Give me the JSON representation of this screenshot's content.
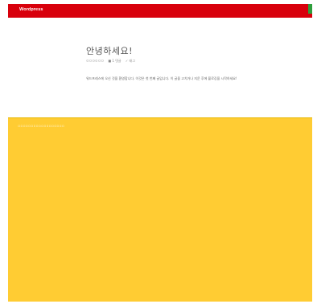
{
  "header": {
    "title": "Wordpress"
  },
  "post": {
    "title": "안녕하세요!",
    "meta": {
      "author": "ㅁㅁㅁㅁㅁㅁ",
      "comments": "■ 1 댓글",
      "tags": "✓ 태그"
    },
    "body": "워드프레스에 오신 것을 환영합니다. 이것은 첫 번째 글입니다. 이 글을 고치거나 지운 후에 블로깅을 시작하세요!"
  },
  "footer": {
    "text": "ㅁㅁㅁㅁㅁㅁㅁㅁㅁㅁㅁㅁㅁㅁㅁㅁㅁㅁ"
  },
  "colors": {
    "header_bg": "#d8000c",
    "corner_accent": "#2e9e3c",
    "footer_bg": "#ffcc33"
  }
}
